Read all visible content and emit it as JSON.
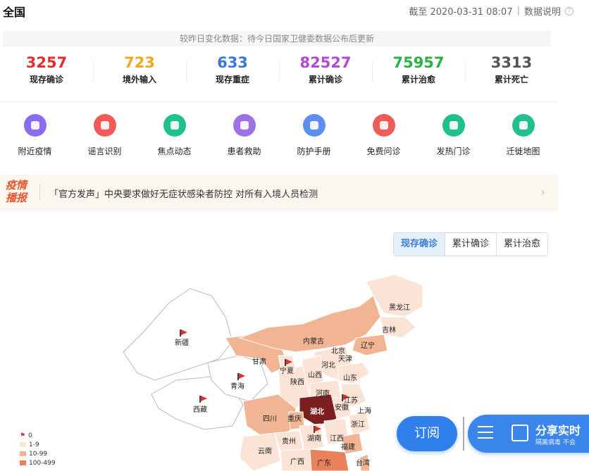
{
  "header": {
    "title": "全国",
    "updated": "截至 2020-03-31 08:07",
    "explain": "数据说明"
  },
  "note": "较昨日变化数据：待今日国家卫健委数据公布后更新",
  "stats": [
    {
      "value": "3257",
      "label": "现存确诊",
      "color": "#e02f2f"
    },
    {
      "value": "723",
      "label": "境外输入",
      "color": "#f5a623"
    },
    {
      "value": "633",
      "label": "现存重症",
      "color": "#3a78d8"
    },
    {
      "value": "82527",
      "label": "累计确诊",
      "color": "#b04bd6"
    },
    {
      "value": "75957",
      "label": "累计治愈",
      "color": "#2bb04a"
    },
    {
      "value": "3313",
      "label": "累计死亡",
      "color": "#555555"
    }
  ],
  "shortcuts": [
    {
      "label": "附近疫情",
      "icon": "location-pin-icon",
      "color": "#8b6cf0"
    },
    {
      "label": "谣言识别",
      "icon": "rumor-icon",
      "color": "#f05b58"
    },
    {
      "label": "焦点动态",
      "icon": "compass-icon",
      "color": "#1fc08a"
    },
    {
      "label": "患者救助",
      "icon": "heart-icon",
      "color": "#9d72e6"
    },
    {
      "label": "防护手册",
      "icon": "book-icon",
      "color": "#5b8ff0"
    },
    {
      "label": "免费问诊",
      "icon": "chart-icon",
      "color": "#f05b58"
    },
    {
      "label": "发热门诊",
      "icon": "medical-kit-icon",
      "color": "#1fc08a"
    },
    {
      "label": "迁徙地图",
      "icon": "target-icon",
      "color": "#22c08f"
    }
  ],
  "news": {
    "badge": "疫情播报",
    "text": "「官方发声」中央要求做好无症状感染者防控 对所有入境人员检测"
  },
  "tabs": [
    "现存确诊",
    "累计确诊",
    "累计治愈"
  ],
  "map": {
    "provinces": [
      "新疆",
      "西藏",
      "青海",
      "甘肃",
      "宁夏",
      "内蒙古",
      "黑龙江",
      "吉林",
      "辽宁",
      "北京",
      "天津",
      "河北",
      "山西",
      "陕西",
      "山东",
      "河南",
      "江苏",
      "安徽",
      "上海",
      "湖北",
      "四川",
      "重庆",
      "浙江",
      "贵州",
      "湖南",
      "江西",
      "福建",
      "云南",
      "广西",
      "广东",
      "台湾"
    ],
    "legend": [
      "0",
      "1-9",
      "10-99",
      "100-499"
    ],
    "legend_colors": [
      "#ffffff",
      "#fbe3d6",
      "#f2b594",
      "#e9825c"
    ]
  },
  "subscribe": "订阅",
  "share": {
    "title": "分享实时",
    "sub": "隔离病毒  不会"
  }
}
